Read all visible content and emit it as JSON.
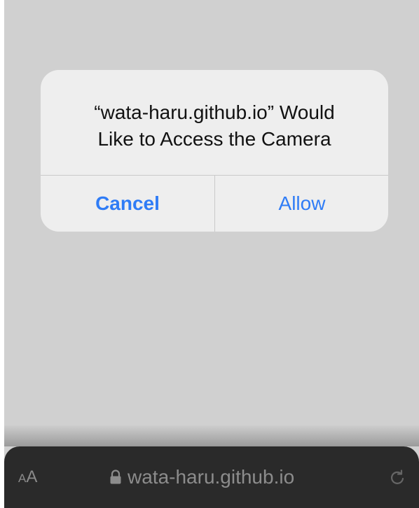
{
  "alert": {
    "title": "“wata-haru.github.io” Would\nLike to Access the Camera",
    "cancel_label": "Cancel",
    "allow_label": "Allow"
  },
  "toolbar": {
    "aa_small": "A",
    "aa_large": "A",
    "url": "wata-haru.github.io",
    "lock_icon": "lock-icon",
    "reload_icon": "reload-icon"
  },
  "colors": {
    "accent": "#2f7cf6",
    "background": "#d0d0d0",
    "dialog": "#eeeeee",
    "toolbar": "#2a2a2a"
  }
}
